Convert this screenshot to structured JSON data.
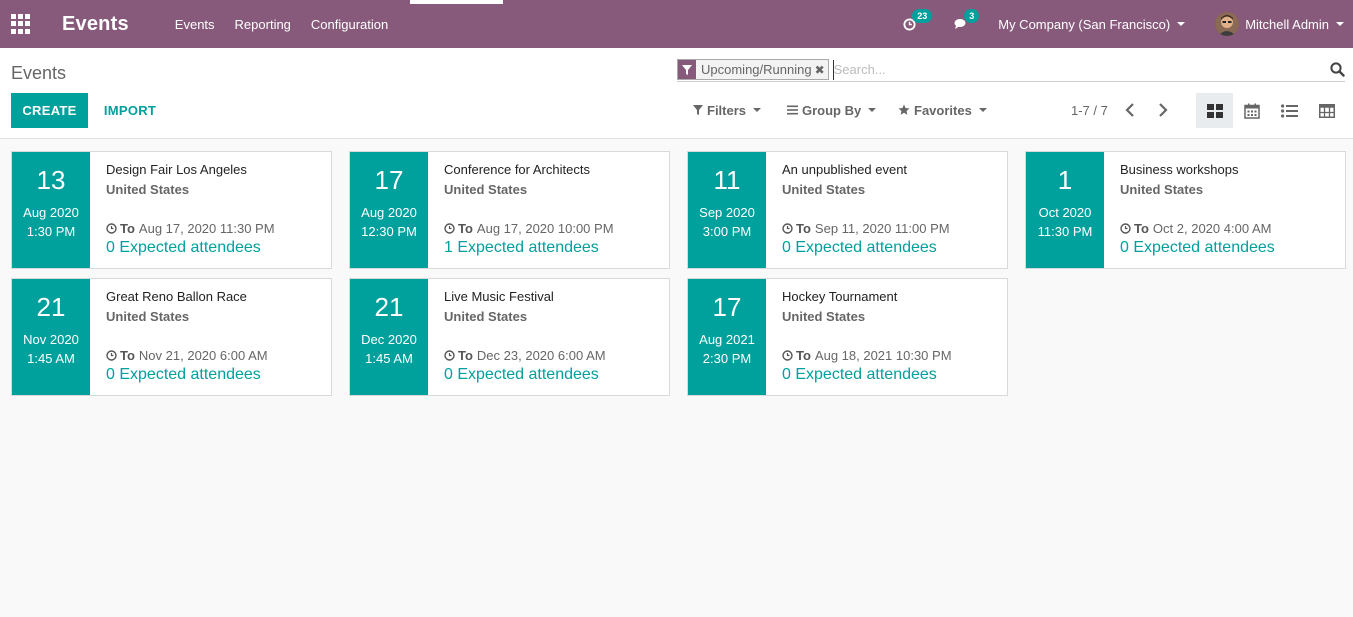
{
  "navbar": {
    "app_title": "Events",
    "menu": [
      "Events",
      "Reporting",
      "Configuration"
    ],
    "activity_count": "23",
    "message_count": "3",
    "company": "My Company (San Francisco)",
    "user": "Mitchell Admin"
  },
  "control": {
    "breadcrumb": "Events",
    "facet": "Upcoming/Running",
    "search_placeholder": "Search...",
    "create_label": "CREATE",
    "import_label": "IMPORT",
    "filters_label": "Filters",
    "groupby_label": "Group By",
    "favorites_label": "Favorites",
    "pager": "1-7 / 7"
  },
  "events": [
    {
      "day": "13",
      "month": "Aug 2020",
      "time": "1:30 PM",
      "name": "Design Fair Los Angeles",
      "country": "United States",
      "to_label": "To",
      "to": "Aug 17, 2020 11:30 PM",
      "attendees": "0 Expected attendees"
    },
    {
      "day": "17",
      "month": "Aug 2020",
      "time": "12:30 PM",
      "name": "Conference for Architects",
      "country": "United States",
      "to_label": "To",
      "to": "Aug 17, 2020 10:00 PM",
      "attendees": "1 Expected attendees"
    },
    {
      "day": "11",
      "month": "Sep 2020",
      "time": "3:00 PM",
      "name": "An unpublished event",
      "country": "United States",
      "to_label": "To",
      "to": "Sep 11, 2020 11:00 PM",
      "attendees": "0 Expected attendees"
    },
    {
      "day": "1",
      "month": "Oct 2020",
      "time": "11:30 PM",
      "name": "Business workshops",
      "country": "United States",
      "to_label": "To",
      "to": "Oct 2, 2020 4:00 AM",
      "attendees": "0 Expected attendees"
    },
    {
      "day": "21",
      "month": "Nov 2020",
      "time": "1:45 AM",
      "name": "Great Reno Ballon Race",
      "country": "United States",
      "to_label": "To",
      "to": "Nov 21, 2020 6:00 AM",
      "attendees": "0 Expected attendees"
    },
    {
      "day": "21",
      "month": "Dec 2020",
      "time": "1:45 AM",
      "name": "Live Music Festival",
      "country": "United States",
      "to_label": "To",
      "to": "Dec 23, 2020 6:00 AM",
      "attendees": "0 Expected attendees"
    },
    {
      "day": "17",
      "month": "Aug 2021",
      "time": "2:30 PM",
      "name": "Hockey Tournament",
      "country": "United States",
      "to_label": "To",
      "to": "Aug 18, 2021 10:30 PM",
      "attendees": "0 Expected attendees"
    }
  ],
  "colors": {
    "brand": "#875a7b",
    "accent": "#00a09d"
  }
}
